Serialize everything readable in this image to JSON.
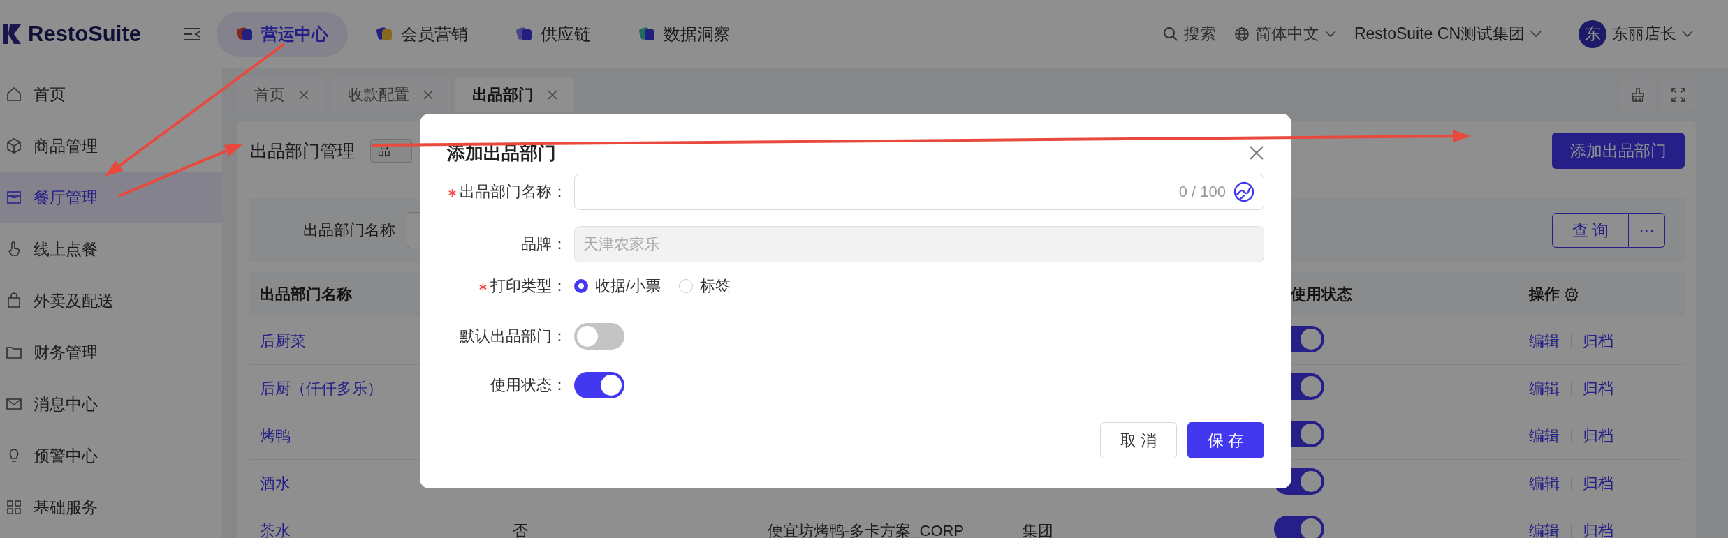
{
  "header": {
    "logo": "RestoSuite",
    "modules": [
      {
        "label": "营运中心",
        "selected": true
      },
      {
        "label": "会员营销",
        "selected": false
      },
      {
        "label": "供应链",
        "selected": false
      },
      {
        "label": "数据洞察",
        "selected": false
      }
    ],
    "search": "搜索",
    "language": "简体中文",
    "org": "RestoSuite CN测试集团",
    "avatar": "东",
    "user": "东丽店长"
  },
  "sidebar": {
    "items": [
      {
        "label": "首页",
        "selected": false
      },
      {
        "label": "商品管理",
        "selected": false
      },
      {
        "label": "餐厅管理",
        "selected": true
      },
      {
        "label": "线上点餐",
        "selected": false
      },
      {
        "label": "外卖及配送",
        "selected": false
      },
      {
        "label": "财务管理",
        "selected": false
      },
      {
        "label": "消息中心",
        "selected": false
      },
      {
        "label": "预警中心",
        "selected": false
      },
      {
        "label": "基础服务",
        "selected": false
      }
    ]
  },
  "tabs": [
    {
      "label": "首页",
      "selected": false
    },
    {
      "label": "收款配置",
      "selected": false
    },
    {
      "label": "出品部门",
      "selected": true
    }
  ],
  "page": {
    "title": "出品部门管理",
    "tag": "品",
    "add_button": "添加出品部门",
    "filter_label": "出品部门名称",
    "query_button": "查询",
    "more_button": "···"
  },
  "table": {
    "columns": [
      "出品部门名称",
      "使用状态",
      "操作"
    ],
    "rows": [
      {
        "name": "后厨菜",
        "on": true,
        "actions": [
          "编辑",
          "归档"
        ]
      },
      {
        "name": "后厨（仟仟多乐）",
        "on": true,
        "actions": [
          "编辑",
          "归档"
        ]
      },
      {
        "name": "烤鸭",
        "on": true,
        "actions": [
          "编辑",
          "归档"
        ]
      },
      {
        "name": "酒水",
        "on": true,
        "actions": [
          "编辑",
          "归档"
        ]
      },
      {
        "name": "茶水",
        "column_2": "否",
        "column_3": "便宜坊烤鸭-多卡方案_CORP",
        "column_4": "集团",
        "on": true,
        "actions": [
          "编辑",
          "归档"
        ]
      }
    ]
  },
  "modal": {
    "title": "添加出品部门",
    "fields": [
      {
        "kind": "text",
        "label": "出品部门名称：",
        "required": true,
        "disabled": false,
        "counter": "0 / 100"
      },
      {
        "kind": "text",
        "label": "品牌：",
        "required": false,
        "disabled": true,
        "value": "天津农家乐"
      },
      {
        "kind": "radio",
        "label": "打印类型：",
        "required": true,
        "options": [
          {
            "label": "收据/小票",
            "selected": true
          },
          {
            "label": "标签",
            "selected": false
          }
        ]
      },
      {
        "kind": "switch",
        "label": "默认出品部门：",
        "required": false,
        "on": false
      },
      {
        "kind": "switch",
        "label": "使用状态：",
        "required": false,
        "on": true
      }
    ],
    "buttons": [
      {
        "label": "取消",
        "kind": "default"
      },
      {
        "label": "保存",
        "kind": "primary"
      }
    ]
  }
}
